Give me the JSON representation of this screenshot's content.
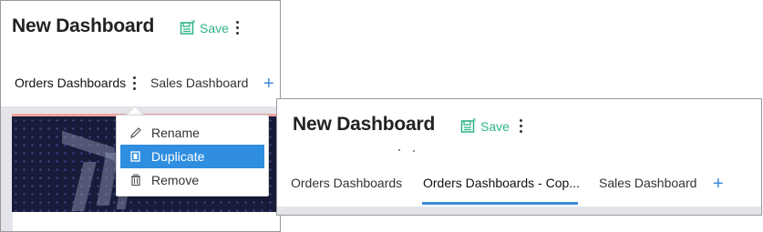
{
  "left_panel": {
    "title": "New Dashboard",
    "save_label": "Save",
    "tabs": [
      {
        "label": "Orders Dashboards"
      },
      {
        "label": "Sales Dashboard"
      }
    ],
    "add_tab_glyph": "+",
    "menu": {
      "items": [
        {
          "label": "Rename",
          "icon": "pencil-icon"
        },
        {
          "label": "Duplicate",
          "icon": "copy-icon",
          "selected": true
        },
        {
          "label": "Remove",
          "icon": "trash-icon"
        }
      ]
    }
  },
  "right_panel": {
    "title": "New Dashboard",
    "save_label": "Save",
    "tabs": [
      {
        "label": "Orders Dashboards"
      },
      {
        "label": "Orders Dashboards - Cop...",
        "active": true
      },
      {
        "label": "Sales Dashboard"
      }
    ],
    "add_tab_glyph": "+"
  },
  "colors": {
    "accent_blue": "#3b8ad9",
    "menu_selected": "#2f8ee0",
    "save_green": "#2fb38a",
    "preview_bg": "#181b3a",
    "preview_border": "#f2a3a0"
  }
}
